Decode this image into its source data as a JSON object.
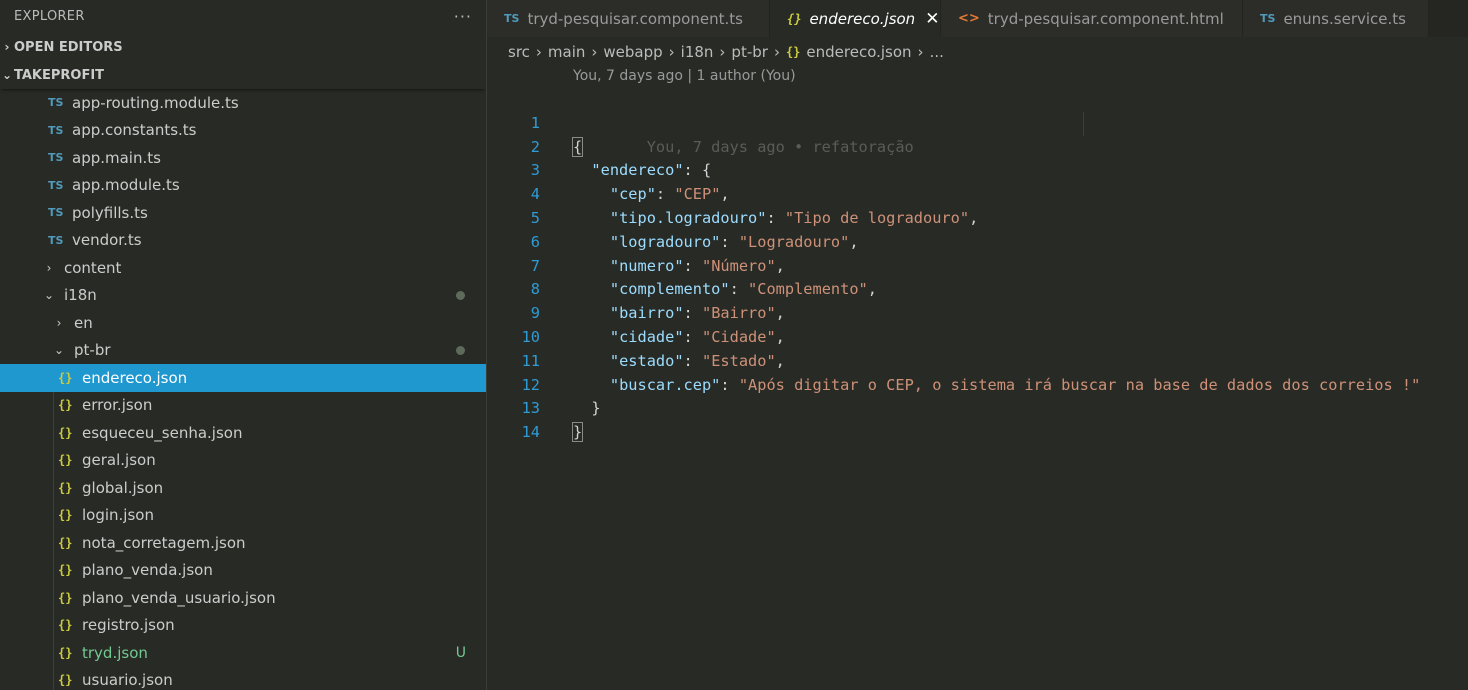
{
  "explorer": {
    "title": "EXPLORER",
    "more": "···",
    "open_editors": "OPEN EDITORS",
    "project": "TAKEPROFIT",
    "items": [
      {
        "label": "app-routing.module.ts",
        "type": "ts"
      },
      {
        "label": "app.constants.ts",
        "type": "ts"
      },
      {
        "label": "app.main.ts",
        "type": "ts"
      },
      {
        "label": "app.module.ts",
        "type": "ts"
      },
      {
        "label": "polyfills.ts",
        "type": "ts"
      },
      {
        "label": "vendor.ts",
        "type": "ts"
      },
      {
        "label": "content",
        "type": "folder"
      },
      {
        "label": "i18n",
        "type": "folder-open"
      },
      {
        "label": "en",
        "type": "folder"
      },
      {
        "label": "pt-br",
        "type": "folder-open"
      },
      {
        "label": "endereco.json",
        "type": "json"
      },
      {
        "label": "error.json",
        "type": "json"
      },
      {
        "label": "esqueceu_senha.json",
        "type": "json"
      },
      {
        "label": "geral.json",
        "type": "json"
      },
      {
        "label": "global.json",
        "type": "json"
      },
      {
        "label": "login.json",
        "type": "json"
      },
      {
        "label": "nota_corretagem.json",
        "type": "json"
      },
      {
        "label": "plano_venda.json",
        "type": "json"
      },
      {
        "label": "plano_venda_usuario.json",
        "type": "json"
      },
      {
        "label": "registro.json",
        "type": "json"
      },
      {
        "label": "tryd.json",
        "type": "json"
      },
      {
        "label": "usuario.json",
        "type": "json"
      }
    ],
    "untracked_badge": "U"
  },
  "icons": {
    "ts": "TS",
    "json": "{}",
    "html": "<>",
    "close": "✕",
    "chevron_right": "›",
    "chevron_down": "⌄"
  },
  "tabs": [
    {
      "label": "tryd-pesquisar.component.ts",
      "type": "ts"
    },
    {
      "label": "endereco.json",
      "type": "json",
      "active": true
    },
    {
      "label": "tryd-pesquisar.component.html",
      "type": "html"
    },
    {
      "label": "enuns.service.ts",
      "type": "ts"
    }
  ],
  "breadcrumb": [
    "src",
    "main",
    "webapp",
    "i18n",
    "pt-br",
    "endereco.json",
    "..."
  ],
  "blame": {
    "header": "You, 7 days ago | 1 author (You)",
    "inline": "You, 7 days ago • refatoração"
  },
  "code": {
    "line_numbers": [
      "1",
      "2",
      "3",
      "4",
      "5",
      "6",
      "7",
      "8",
      "9",
      "10",
      "11",
      "12",
      "13",
      "14"
    ],
    "root_key": "endereco",
    "entries": [
      {
        "key": "cep",
        "value": "CEP"
      },
      {
        "key": "tipo.logradouro",
        "value": "Tipo de logradouro"
      },
      {
        "key": "logradouro",
        "value": "Logradouro"
      },
      {
        "key": "numero",
        "value": "Número"
      },
      {
        "key": "complemento",
        "value": "Complemento"
      },
      {
        "key": "bairro",
        "value": "Bairro"
      },
      {
        "key": "cidade",
        "value": "Cidade"
      },
      {
        "key": "estado",
        "value": "Estado"
      },
      {
        "key": "buscar.cep",
        "value": "Após digitar o CEP, o sistema irá buscar na base de dados dos correios !"
      }
    ]
  },
  "colors": {
    "selected_row": "#1f97cf",
    "json_key": "#9cdcfe",
    "json_string": "#ce9178",
    "line_number": "#2f9cd6",
    "untracked": "#73c991"
  }
}
